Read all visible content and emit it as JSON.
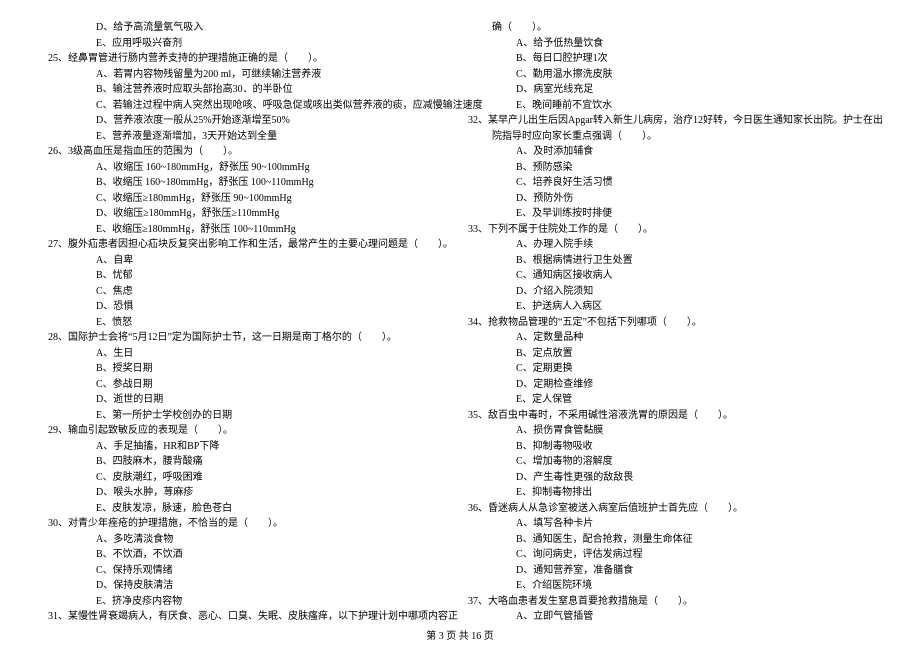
{
  "footer": "第 3 页 共 16 页",
  "left": [
    {
      "cls": "opt",
      "t": "D、给予高流量氧气吸入"
    },
    {
      "cls": "opt",
      "t": "E、应用呼吸兴奋剂"
    },
    {
      "cls": "q",
      "t": "25、经鼻胃管进行肠内营养支持的护理措施正确的是（　　）。"
    },
    {
      "cls": "opt",
      "t": "A、若胃内容物残留量为200 ml，可继续输注营养液"
    },
    {
      "cls": "opt",
      "t": "B、输注营养液时应取头部抬高30．的半卧位"
    },
    {
      "cls": "opt",
      "t": "C、若输注过程中病人突然出现呛咳、呼吸急促或咳出类似营养液的痰，应减慢输注速度"
    },
    {
      "cls": "opt",
      "t": "D、营养液浓度一般从25%开始逐渐增至50%"
    },
    {
      "cls": "opt",
      "t": "E、营养液量逐渐增加，3天开始达到全量"
    },
    {
      "cls": "q",
      "t": "26、3级高血压是指血压的范围为（　　）。"
    },
    {
      "cls": "opt",
      "t": "A、收缩压 160~180mmHg，舒张压 90~100mmHg"
    },
    {
      "cls": "opt",
      "t": "B、收缩压 160~180mmHg，舒张压 100~110mmHg"
    },
    {
      "cls": "opt",
      "t": "C、收缩压≥180mmHg，舒张压 90~100mmHg"
    },
    {
      "cls": "opt",
      "t": "D、收缩压≥180mmHg，舒张压≥110mmHg"
    },
    {
      "cls": "opt",
      "t": "E、收缩压≥180mmHg，舒张压 100~110mmHg"
    },
    {
      "cls": "q",
      "t": "27、腹外疝患者因担心疝块反复突出影响工作和生活，最常产生的主要心理问题是（　　）。"
    },
    {
      "cls": "opt",
      "t": "A、自卑"
    },
    {
      "cls": "opt",
      "t": "B、忧郁"
    },
    {
      "cls": "opt",
      "t": "C、焦虑"
    },
    {
      "cls": "opt",
      "t": "D、恐惧"
    },
    {
      "cls": "opt",
      "t": "E、愤怒"
    },
    {
      "cls": "q",
      "t": "28、国际护士会将“5月12日”定为国际护士节，这一日期是南丁格尔的（　　）。"
    },
    {
      "cls": "opt",
      "t": "A、生日"
    },
    {
      "cls": "opt",
      "t": "B、授奖日期"
    },
    {
      "cls": "opt",
      "t": "C、参战日期"
    },
    {
      "cls": "opt",
      "t": "D、逝世的日期"
    },
    {
      "cls": "opt",
      "t": "E、第一所护士学校创办的日期"
    },
    {
      "cls": "q",
      "t": "29、输血引起致敏反应的表现是（　　）。"
    },
    {
      "cls": "opt",
      "t": "A、手足抽搐，HR和BP下降"
    },
    {
      "cls": "opt",
      "t": "B、四肢麻木，腰背酸痛"
    },
    {
      "cls": "opt",
      "t": "C、皮肤潮红，呼吸困难"
    },
    {
      "cls": "opt",
      "t": "D、喉头水肿，荨麻疹"
    },
    {
      "cls": "opt",
      "t": "E、皮肤发凉，脉速，脸色苍白"
    },
    {
      "cls": "q",
      "t": "30、对青少年痤疮的护理措施，不恰当的是（　　）。"
    },
    {
      "cls": "opt",
      "t": "A、多吃清淡食物"
    },
    {
      "cls": "opt",
      "t": "B、不饮酒，不饮酒"
    },
    {
      "cls": "opt",
      "t": "C、保持乐观情绪"
    },
    {
      "cls": "opt",
      "t": "D、保持皮肤清洁"
    },
    {
      "cls": "opt",
      "t": "E、挤净皮疹内容物"
    },
    {
      "cls": "q",
      "t": "31、某慢性肾衰竭病人，有厌食、恶心、口臭、失眠、皮肤瘙痒，以下护理计划中哪项内容正"
    }
  ],
  "right": [
    {
      "cls": "sub",
      "t": "确（　　）。"
    },
    {
      "cls": "opt",
      "t": "A、给予低热量饮食"
    },
    {
      "cls": "opt",
      "t": "B、每日口腔护理1次"
    },
    {
      "cls": "opt",
      "t": "C、勤用温水擦洗皮肤"
    },
    {
      "cls": "opt",
      "t": "D、病室光线充足"
    },
    {
      "cls": "opt",
      "t": "E、晚间睡前不宜饮水"
    },
    {
      "cls": "q",
      "t": "32、某早产儿出生后因Apgar转入新生儿病房，治疗12好转，今日医生通知家长出院。护士在出"
    },
    {
      "cls": "sub",
      "t": "院指导时应向家长重点强调（　　）。"
    },
    {
      "cls": "opt",
      "t": "A、及时添加辅食"
    },
    {
      "cls": "opt",
      "t": "B、预防感染"
    },
    {
      "cls": "opt",
      "t": "C、培养良好生活习惯"
    },
    {
      "cls": "opt",
      "t": "D、预防外伤"
    },
    {
      "cls": "opt",
      "t": "E、及早训练按时排便"
    },
    {
      "cls": "q",
      "t": "33、下列不属于住院处工作的是（　　）。"
    },
    {
      "cls": "opt",
      "t": "A、办理入院手续"
    },
    {
      "cls": "opt",
      "t": "B、根据病情进行卫生处置"
    },
    {
      "cls": "opt",
      "t": "C、通知病区接收病人"
    },
    {
      "cls": "opt",
      "t": "D、介绍入院须知"
    },
    {
      "cls": "opt",
      "t": "E、护送病人入病区"
    },
    {
      "cls": "q",
      "t": "34、抢救物品管理的“五定”不包括下列哪项（　　）。"
    },
    {
      "cls": "opt",
      "t": "A、定数量品种"
    },
    {
      "cls": "opt",
      "t": "B、定点放置"
    },
    {
      "cls": "opt",
      "t": "C、定期更换"
    },
    {
      "cls": "opt",
      "t": "D、定期检查维修"
    },
    {
      "cls": "opt",
      "t": "E、定人保管"
    },
    {
      "cls": "q",
      "t": "35、敌百虫中毒时，不采用碱性溶液洗胃的原因是（　　）。"
    },
    {
      "cls": "opt",
      "t": "A、损伤胃食管黏膜"
    },
    {
      "cls": "opt",
      "t": "B、抑制毒物吸收"
    },
    {
      "cls": "opt",
      "t": "C、增加毒物的溶解度"
    },
    {
      "cls": "opt",
      "t": "D、产生毒性更强的敌敌畏"
    },
    {
      "cls": "opt",
      "t": "E、抑制毒物排出"
    },
    {
      "cls": "q",
      "t": "36、昏迷病人从急诊室被送入病室后值班护士首先应（　　）。"
    },
    {
      "cls": "opt",
      "t": "A、填写各种卡片"
    },
    {
      "cls": "opt",
      "t": "B、通知医生，配合抢救，测量生命体征"
    },
    {
      "cls": "opt",
      "t": "C、询问病史，评估发病过程"
    },
    {
      "cls": "opt",
      "t": "D、通知营养室，准备膳食"
    },
    {
      "cls": "opt",
      "t": "E、介绍医院环境"
    },
    {
      "cls": "q",
      "t": "37、大咯血患者发生窒息首要抢救措施是（　　）。"
    },
    {
      "cls": "opt",
      "t": "A、立即气管插管"
    }
  ]
}
